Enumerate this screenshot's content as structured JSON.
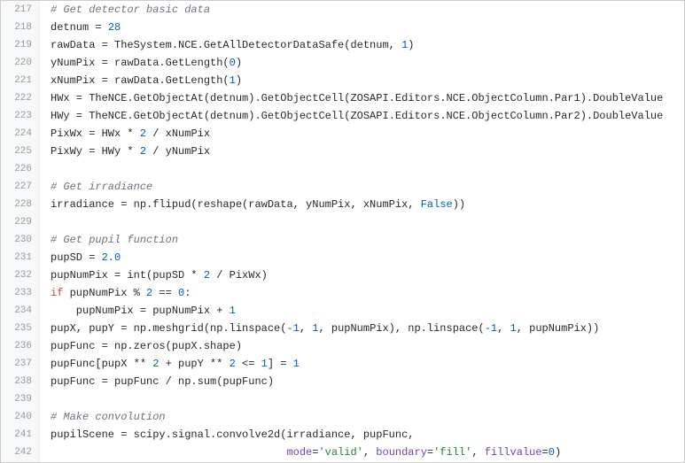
{
  "chart_data": {
    "type": "table",
    "lines": [
      {
        "no": 217,
        "tokens": [
          {
            "t": "# Get detector basic data",
            "c": "c"
          }
        ]
      },
      {
        "no": 218,
        "tokens": [
          {
            "t": "detnum = "
          },
          {
            "t": "28",
            "c": "n"
          }
        ]
      },
      {
        "no": 219,
        "tokens": [
          {
            "t": "rawData = TheSystem.NCE.GetAllDetectorDataSafe(detnum, "
          },
          {
            "t": "1",
            "c": "n"
          },
          {
            "t": ")"
          }
        ]
      },
      {
        "no": 220,
        "tokens": [
          {
            "t": "yNumPix = rawData.GetLength("
          },
          {
            "t": "0",
            "c": "n"
          },
          {
            "t": ")"
          }
        ]
      },
      {
        "no": 221,
        "tokens": [
          {
            "t": "xNumPix = rawData.GetLength("
          },
          {
            "t": "1",
            "c": "n"
          },
          {
            "t": ")"
          }
        ]
      },
      {
        "no": 222,
        "tokens": [
          {
            "t": "HWx = TheNCE.GetObjectAt(detnum).GetObjectCell(ZOSAPI.Editors.NCE.ObjectColumn.Par1).DoubleValue"
          }
        ]
      },
      {
        "no": 223,
        "tokens": [
          {
            "t": "HWy = TheNCE.GetObjectAt(detnum).GetObjectCell(ZOSAPI.Editors.NCE.ObjectColumn.Par2).DoubleValue"
          }
        ]
      },
      {
        "no": 224,
        "tokens": [
          {
            "t": "PixWx = HWx * "
          },
          {
            "t": "2",
            "c": "n"
          },
          {
            "t": " / xNumPix"
          }
        ]
      },
      {
        "no": 225,
        "tokens": [
          {
            "t": "PixWy = HWy * "
          },
          {
            "t": "2",
            "c": "n"
          },
          {
            "t": " / yNumPix"
          }
        ]
      },
      {
        "no": 226,
        "tokens": []
      },
      {
        "no": 227,
        "tokens": [
          {
            "t": "# Get irradiance",
            "c": "c"
          }
        ]
      },
      {
        "no": 228,
        "tokens": [
          {
            "t": "irradiance = np.flipud(reshape(rawData, yNumPix, xNumPix, "
          },
          {
            "t": "False",
            "c": "b"
          },
          {
            "t": "))"
          }
        ]
      },
      {
        "no": 229,
        "tokens": []
      },
      {
        "no": 230,
        "tokens": [
          {
            "t": "# Get pupil function",
            "c": "c"
          }
        ]
      },
      {
        "no": 231,
        "tokens": [
          {
            "t": "pupSD = "
          },
          {
            "t": "2.0",
            "c": "n"
          }
        ]
      },
      {
        "no": 232,
        "tokens": [
          {
            "t": "pupNumPix = int(pupSD * "
          },
          {
            "t": "2",
            "c": "n"
          },
          {
            "t": " / PixWx)"
          }
        ]
      },
      {
        "no": 233,
        "tokens": [
          {
            "t": "if",
            "c": "k"
          },
          {
            "t": " pupNumPix % "
          },
          {
            "t": "2",
            "c": "n"
          },
          {
            "t": " == "
          },
          {
            "t": "0",
            "c": "n"
          },
          {
            "t": ":"
          }
        ]
      },
      {
        "no": 234,
        "tokens": [
          {
            "t": "    pupNumPix = pupNumPix + "
          },
          {
            "t": "1",
            "c": "n"
          }
        ]
      },
      {
        "no": 235,
        "tokens": [
          {
            "t": "pupX, pupY = np.meshgrid(np.linspace("
          },
          {
            "t": "-1",
            "c": "n"
          },
          {
            "t": ", "
          },
          {
            "t": "1",
            "c": "n"
          },
          {
            "t": ", pupNumPix), np.linspace("
          },
          {
            "t": "-1",
            "c": "n"
          },
          {
            "t": ", "
          },
          {
            "t": "1",
            "c": "n"
          },
          {
            "t": ", pupNumPix))"
          }
        ]
      },
      {
        "no": 236,
        "tokens": [
          {
            "t": "pupFunc = np.zeros(pupX.shape)"
          }
        ]
      },
      {
        "no": 237,
        "tokens": [
          {
            "t": "pupFunc[pupX ** "
          },
          {
            "t": "2",
            "c": "n"
          },
          {
            "t": " + pupY ** "
          },
          {
            "t": "2",
            "c": "n"
          },
          {
            "t": " <= "
          },
          {
            "t": "1",
            "c": "n"
          },
          {
            "t": "] = "
          },
          {
            "t": "1",
            "c": "n"
          }
        ]
      },
      {
        "no": 238,
        "tokens": [
          {
            "t": "pupFunc = pupFunc / np.sum(pupFunc)"
          }
        ]
      },
      {
        "no": 239,
        "tokens": []
      },
      {
        "no": 240,
        "tokens": [
          {
            "t": "# Make convolution",
            "c": "c"
          }
        ]
      },
      {
        "no": 241,
        "tokens": [
          {
            "t": "pupilScene = scipy.signal.convolve2d(irradiance, pupFunc,"
          }
        ]
      },
      {
        "no": 242,
        "tokens": [
          {
            "t": "                                     "
          },
          {
            "t": "mode",
            "c": "kw"
          },
          {
            "t": "="
          },
          {
            "t": "'valid'",
            "c": "s"
          },
          {
            "t": ", "
          },
          {
            "t": "boundary",
            "c": "kw"
          },
          {
            "t": "="
          },
          {
            "t": "'fill'",
            "c": "s"
          },
          {
            "t": ", "
          },
          {
            "t": "fillvalue",
            "c": "kw"
          },
          {
            "t": "="
          },
          {
            "t": "0",
            "c": "n"
          },
          {
            "t": ")"
          }
        ]
      }
    ]
  }
}
